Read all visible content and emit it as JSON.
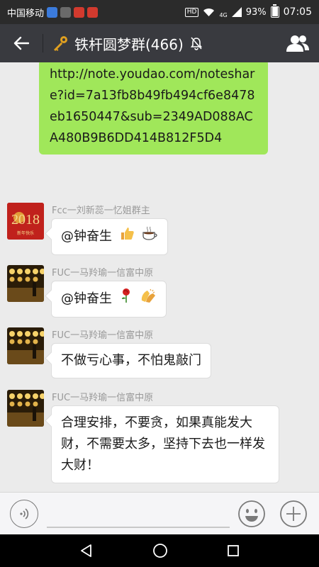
{
  "status_bar": {
    "carrier": "中国移动",
    "hd": "HD",
    "network": "4G",
    "battery": "93%",
    "battery_level": 0.93,
    "time": "07:05"
  },
  "title_bar": {
    "group_name": "铁杆圆梦群(466)"
  },
  "messages": {
    "outgoing_link": "http://note.youdao.com/noteshare?id=7a13fb8b49fb494cf6e8478eb1650447&sub=2349AD088ACA480B9B6DD414B812F5D4",
    "m1": {
      "sender": "Fcc一刘新蕊一忆姐群主",
      "text": "@钟奋生",
      "avatar_text": "2018",
      "avatar_sub": "新年快乐"
    },
    "m2": {
      "sender": "FUC一马羚瑜一信富中原",
      "text": "@钟奋生"
    },
    "m3": {
      "sender": "FUC一马羚瑜一信富中原",
      "text": "不做亏心事，不怕鬼敲门"
    },
    "m4": {
      "sender": "FUC一马羚瑜一信富中原",
      "text": "合理安排，不要贪，如果真能发大财，不需要太多，坚持下去也一样发大财！"
    }
  },
  "colors": {
    "outgoing_bubble": "#a0e75a",
    "title_bar": "#393a3f",
    "status_bar": "#2b2b2b"
  },
  "icons": [
    "back-arrow-icon",
    "key-icon",
    "mute-bell-icon",
    "group-contacts-icon",
    "voice-icon",
    "emoji-face-icon",
    "plus-icon",
    "thumbs-up-icon",
    "coffee-icon",
    "rose-icon",
    "clap-icon",
    "nav-back-icon",
    "nav-home-icon",
    "nav-recents-icon"
  ]
}
